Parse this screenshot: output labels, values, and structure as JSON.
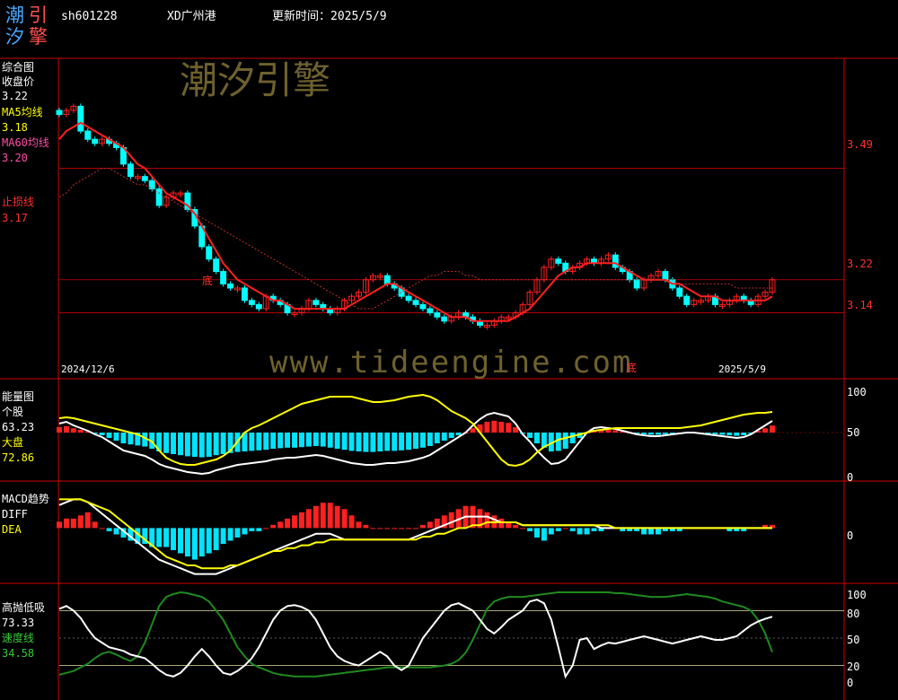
{
  "header": {
    "logo_chars": [
      "潮",
      "引",
      "汐",
      "擎"
    ],
    "code": "sh601228",
    "name": "XD广州港",
    "update_label": "更新时间：2025/5/9"
  },
  "watermarks": {
    "cn": "潮汐引擎",
    "url": "www.tideengine.com"
  },
  "colors": {
    "up": "#ff2020",
    "down": "#00ffff",
    "ma5": "#ffffff",
    "ma60": "#ff3030",
    "stop": "#ffffff",
    "grid": "#cc0000",
    "diff": "#ffffff",
    "dea": "#ffff00",
    "fast": "#ffffff",
    "speed": "#1f8a1f"
  },
  "panels": {
    "main": {
      "title": "综合图",
      "label_close": "收盘价",
      "value_close": "3.22",
      "label_ma5": "MA5均线",
      "value_ma5": "3.18",
      "label_ma60": "MA60均线",
      "value_ma60": "3.20",
      "label_stop": "止损线",
      "value_stop": "3.17",
      "date_start": "2024/12/6",
      "date_end": "2025/5/9",
      "bottom_marks": [
        "底",
        "底"
      ],
      "price_ticks": [
        "3.49",
        "3.22",
        "3.14"
      ]
    },
    "energy": {
      "title": "能量图",
      "label_stock": "个股",
      "value_stock": "63.23",
      "label_market": "大盘",
      "value_market": "72.86",
      "ticks": [
        "100",
        "50",
        "0"
      ]
    },
    "macd": {
      "title": "MACD趋势",
      "label_diff": "DIFF",
      "label_dea": "DEA",
      "ticks": [
        "0"
      ]
    },
    "gaopao": {
      "title": "高抛低吸",
      "value_main": "73.33",
      "label_speed": "速度线",
      "value_speed": "34.58",
      "ticks": [
        "100",
        "80",
        "50",
        "20",
        "0"
      ]
    }
  },
  "chart_data": {
    "type": "candlestick",
    "title": "XD广州港",
    "date_range": [
      "2024/12/6",
      "2025/5/9"
    ],
    "price_levels": [
      3.49,
      3.22,
      3.14
    ],
    "close": [
      3.62,
      3.63,
      3.64,
      3.58,
      3.56,
      3.55,
      3.56,
      3.55,
      3.54,
      3.5,
      3.47,
      3.47,
      3.46,
      3.44,
      3.4,
      3.42,
      3.43,
      3.43,
      3.39,
      3.35,
      3.3,
      3.27,
      3.24,
      3.21,
      3.2,
      3.2,
      3.17,
      3.16,
      3.15,
      3.18,
      3.17,
      3.16,
      3.14,
      3.14,
      3.15,
      3.17,
      3.16,
      3.15,
      3.14,
      3.15,
      3.17,
      3.18,
      3.19,
      3.22,
      3.23,
      3.23,
      3.21,
      3.2,
      3.18,
      3.17,
      3.16,
      3.15,
      3.14,
      3.13,
      3.12,
      3.13,
      3.14,
      3.13,
      3.12,
      3.11,
      3.11,
      3.12,
      3.13,
      3.13,
      3.14,
      3.16,
      3.19,
      3.22,
      3.25,
      3.27,
      3.26,
      3.24,
      3.25,
      3.26,
      3.27,
      3.26,
      3.27,
      3.28,
      3.25,
      3.24,
      3.22,
      3.2,
      3.22,
      3.23,
      3.24,
      3.22,
      3.2,
      3.18,
      3.16,
      3.17,
      3.17,
      3.18,
      3.16,
      3.16,
      3.17,
      3.18,
      3.17,
      3.16,
      3.18,
      3.19,
      3.22
    ],
    "ma5": [
      3.56,
      3.58,
      3.59,
      3.6,
      3.59,
      3.58,
      3.57,
      3.56,
      3.55,
      3.54,
      3.52,
      3.5,
      3.49,
      3.47,
      3.45,
      3.43,
      3.42,
      3.41,
      3.4,
      3.38,
      3.35,
      3.32,
      3.29,
      3.26,
      3.24,
      3.22,
      3.21,
      3.2,
      3.19,
      3.18,
      3.17,
      3.17,
      3.16,
      3.15,
      3.15,
      3.15,
      3.15,
      3.15,
      3.15,
      3.15,
      3.15,
      3.16,
      3.17,
      3.18,
      3.19,
      3.2,
      3.21,
      3.21,
      3.2,
      3.19,
      3.18,
      3.17,
      3.16,
      3.15,
      3.14,
      3.13,
      3.13,
      3.13,
      3.12,
      3.12,
      3.12,
      3.12,
      3.12,
      3.12,
      3.13,
      3.14,
      3.15,
      3.17,
      3.19,
      3.21,
      3.23,
      3.24,
      3.25,
      3.25,
      3.26,
      3.26,
      3.26,
      3.26,
      3.26,
      3.25,
      3.24,
      3.23,
      3.22,
      3.22,
      3.22,
      3.22,
      3.21,
      3.21,
      3.2,
      3.19,
      3.18,
      3.18,
      3.18,
      3.17,
      3.17,
      3.17,
      3.17,
      3.17,
      3.17,
      3.17,
      3.18
    ],
    "ma60": [
      3.42,
      3.43,
      3.45,
      3.46,
      3.47,
      3.48,
      3.49,
      3.49,
      3.48,
      3.47,
      3.46,
      3.45,
      3.45,
      3.44,
      3.43,
      3.42,
      3.41,
      3.4,
      3.39,
      3.38,
      3.37,
      3.36,
      3.35,
      3.34,
      3.33,
      3.32,
      3.31,
      3.3,
      3.29,
      3.28,
      3.27,
      3.26,
      3.25,
      3.24,
      3.23,
      3.22,
      3.21,
      3.2,
      3.19,
      3.18,
      3.17,
      3.16,
      3.15,
      3.15,
      3.15,
      3.16,
      3.17,
      3.18,
      3.19,
      3.2,
      3.21,
      3.22,
      3.23,
      3.23,
      3.24,
      3.24,
      3.24,
      3.23,
      3.23,
      3.22,
      3.22,
      3.22,
      3.22,
      3.22,
      3.22,
      3.22,
      3.22,
      3.22,
      3.22,
      3.22,
      3.22,
      3.22,
      3.22,
      3.22,
      3.22,
      3.22,
      3.22,
      3.22,
      3.22,
      3.22,
      3.22,
      3.22,
      3.22,
      3.22,
      3.22,
      3.22,
      3.22,
      3.21,
      3.21,
      3.21,
      3.21,
      3.21,
      3.21,
      3.21,
      3.21,
      3.2,
      3.2,
      3.2,
      3.2,
      3.2,
      3.2
    ],
    "energy_stock": [
      60,
      62,
      58,
      55,
      52,
      48,
      45,
      40,
      35,
      30,
      28,
      26,
      24,
      20,
      15,
      12,
      10,
      8,
      6,
      5,
      4,
      5,
      8,
      10,
      12,
      14,
      15,
      16,
      17,
      18,
      20,
      21,
      22,
      22,
      23,
      24,
      25,
      24,
      22,
      20,
      18,
      16,
      15,
      14,
      14,
      15,
      16,
      16,
      17,
      18,
      20,
      22,
      25,
      30,
      35,
      40,
      45,
      50,
      58,
      65,
      70,
      72,
      70,
      68,
      60,
      48,
      40,
      30,
      22,
      15,
      16,
      20,
      30,
      40,
      50,
      55,
      56,
      55,
      54,
      52,
      50,
      48,
      47,
      46,
      46,
      47,
      48,
      49,
      50,
      50,
      49,
      48,
      47,
      46,
      45,
      44,
      45,
      48,
      53,
      58,
      63
    ],
    "energy_market": [
      66,
      67,
      66,
      64,
      62,
      60,
      58,
      56,
      54,
      52,
      50,
      48,
      44,
      40,
      30,
      22,
      18,
      15,
      14,
      14,
      16,
      18,
      20,
      24,
      30,
      40,
      50,
      55,
      58,
      62,
      66,
      70,
      74,
      78,
      82,
      84,
      86,
      88,
      90,
      90,
      90,
      90,
      88,
      86,
      84,
      84,
      85,
      86,
      88,
      90,
      91,
      92,
      90,
      86,
      80,
      74,
      70,
      66,
      60,
      50,
      40,
      30,
      20,
      14,
      13,
      15,
      20,
      28,
      34,
      38,
      42,
      44,
      46,
      48,
      50,
      52,
      53,
      54,
      55,
      55,
      55,
      55,
      55,
      55,
      55,
      55,
      55,
      55,
      56,
      57,
      58,
      60,
      62,
      64,
      66,
      68,
      70,
      71,
      72,
      72,
      73
    ],
    "macd_hist": [
      0.02,
      0.03,
      0.03,
      0.04,
      0.05,
      0.02,
      0,
      -0.01,
      -0.02,
      -0.03,
      -0.04,
      -0.05,
      -0.05,
      -0.06,
      -0.06,
      -0.06,
      -0.07,
      -0.08,
      -0.09,
      -0.1,
      -0.09,
      -0.08,
      -0.07,
      -0.05,
      -0.04,
      -0.03,
      -0.02,
      -0.01,
      -0.01,
      0,
      0.01,
      0.02,
      0.03,
      0.04,
      0.05,
      0.06,
      0.07,
      0.08,
      0.08,
      0.07,
      0.06,
      0.04,
      0.02,
      0.01,
      0,
      0,
      0,
      0,
      0,
      0,
      0,
      0.01,
      0.02,
      0.03,
      0.04,
      0.05,
      0.06,
      0.07,
      0.07,
      0.06,
      0.05,
      0.04,
      0.03,
      0.02,
      0.01,
      0,
      -0.01,
      -0.03,
      -0.04,
      -0.02,
      -0.01,
      0,
      -0.01,
      -0.02,
      -0.02,
      -0.01,
      -0.01,
      0,
      0,
      -0.01,
      -0.01,
      -0.01,
      -0.02,
      -0.02,
      -0.02,
      -0.01,
      -0.01,
      -0.01,
      0,
      0,
      0,
      0,
      0,
      0,
      -0.01,
      -0.01,
      -0.01,
      0,
      0,
      0.01,
      0.01
    ],
    "diff": [
      0.08,
      0.09,
      0.1,
      0.1,
      0.09,
      0.07,
      0.05,
      0.03,
      0.01,
      -0.01,
      -0.03,
      -0.05,
      -0.07,
      -0.09,
      -0.11,
      -0.12,
      -0.13,
      -0.14,
      -0.15,
      -0.16,
      -0.16,
      -0.16,
      -0.16,
      -0.15,
      -0.14,
      -0.13,
      -0.12,
      -0.11,
      -0.1,
      -0.09,
      -0.08,
      -0.07,
      -0.06,
      -0.05,
      -0.04,
      -0.03,
      -0.02,
      -0.02,
      -0.02,
      -0.03,
      -0.04,
      -0.04,
      -0.04,
      -0.04,
      -0.04,
      -0.04,
      -0.04,
      -0.04,
      -0.04,
      -0.04,
      -0.03,
      -0.02,
      -0.01,
      0,
      0.01,
      0.02,
      0.03,
      0.04,
      0.04,
      0.04,
      0.04,
      0.03,
      0.02,
      0.02,
      0.02,
      0.01,
      0.01,
      0.01,
      0.01,
      0.01,
      0.01,
      0.01,
      0.01,
      0.01,
      0.01,
      0.01,
      0,
      0,
      0,
      0,
      0,
      0,
      0,
      0,
      0,
      0,
      0,
      0,
      0,
      0,
      0,
      0,
      0,
      0,
      0,
      0,
      0,
      0,
      0,
      0,
      0
    ],
    "dea": [
      0.1,
      0.1,
      0.1,
      0.1,
      0.09,
      0.08,
      0.07,
      0.06,
      0.04,
      0.02,
      0,
      -0.02,
      -0.04,
      -0.06,
      -0.08,
      -0.1,
      -0.11,
      -0.12,
      -0.13,
      -0.13,
      -0.14,
      -0.14,
      -0.14,
      -0.14,
      -0.13,
      -0.13,
      -0.12,
      -0.11,
      -0.1,
      -0.09,
      -0.08,
      -0.08,
      -0.07,
      -0.07,
      -0.06,
      -0.06,
      -0.05,
      -0.05,
      -0.04,
      -0.04,
      -0.04,
      -0.04,
      -0.04,
      -0.04,
      -0.04,
      -0.04,
      -0.04,
      -0.04,
      -0.04,
      -0.04,
      -0.04,
      -0.03,
      -0.03,
      -0.02,
      -0.02,
      -0.01,
      0,
      0,
      0.01,
      0.01,
      0.02,
      0.02,
      0.02,
      0.02,
      0.02,
      0.01,
      0.01,
      0.01,
      0.01,
      0.01,
      0.01,
      0.01,
      0.01,
      0.01,
      0.01,
      0.01,
      0.01,
      0.01,
      0,
      0,
      0,
      0,
      0,
      0,
      0,
      0,
      0,
      0,
      0,
      0,
      0,
      0,
      0,
      0,
      0,
      0,
      0,
      0,
      0,
      0,
      0
    ],
    "gaopao_main": [
      82,
      85,
      80,
      72,
      60,
      50,
      45,
      40,
      38,
      36,
      32,
      30,
      28,
      22,
      15,
      10,
      8,
      12,
      20,
      30,
      38,
      30,
      20,
      12,
      10,
      14,
      20,
      28,
      40,
      55,
      70,
      80,
      85,
      86,
      84,
      80,
      70,
      55,
      40,
      30,
      25,
      22,
      20,
      25,
      30,
      35,
      30,
      20,
      15,
      20,
      35,
      50,
      60,
      70,
      80,
      86,
      88,
      84,
      80,
      70,
      60,
      55,
      62,
      70,
      75,
      80,
      90,
      92,
      88,
      70,
      40,
      8,
      20,
      48,
      50,
      38,
      42,
      45,
      44,
      46,
      48,
      50,
      52,
      50,
      48,
      46,
      44,
      46,
      48,
      50,
      52,
      50,
      48,
      48,
      50,
      52,
      58,
      64,
      68,
      71,
      73.33
    ],
    "gaopao_speed": [
      10,
      12,
      14,
      18,
      22,
      28,
      33,
      35,
      32,
      28,
      25,
      30,
      45,
      65,
      85,
      95,
      98,
      100,
      99,
      97,
      95,
      90,
      80,
      70,
      55,
      40,
      30,
      22,
      18,
      15,
      12,
      10,
      9,
      8,
      8,
      8,
      8,
      9,
      10,
      11,
      12,
      13,
      14,
      15,
      16,
      17,
      18,
      18,
      18,
      18,
      18,
      18,
      18,
      19,
      20,
      22,
      26,
      34,
      48,
      65,
      82,
      90,
      93,
      95,
      95,
      95,
      96,
      97,
      98,
      99,
      100,
      100,
      100,
      100,
      100,
      100,
      100,
      100,
      99,
      99,
      98,
      97,
      96,
      95,
      95,
      95,
      96,
      97,
      98,
      97,
      96,
      95,
      93,
      90,
      88,
      86,
      84,
      80,
      70,
      55,
      34.58
    ]
  }
}
